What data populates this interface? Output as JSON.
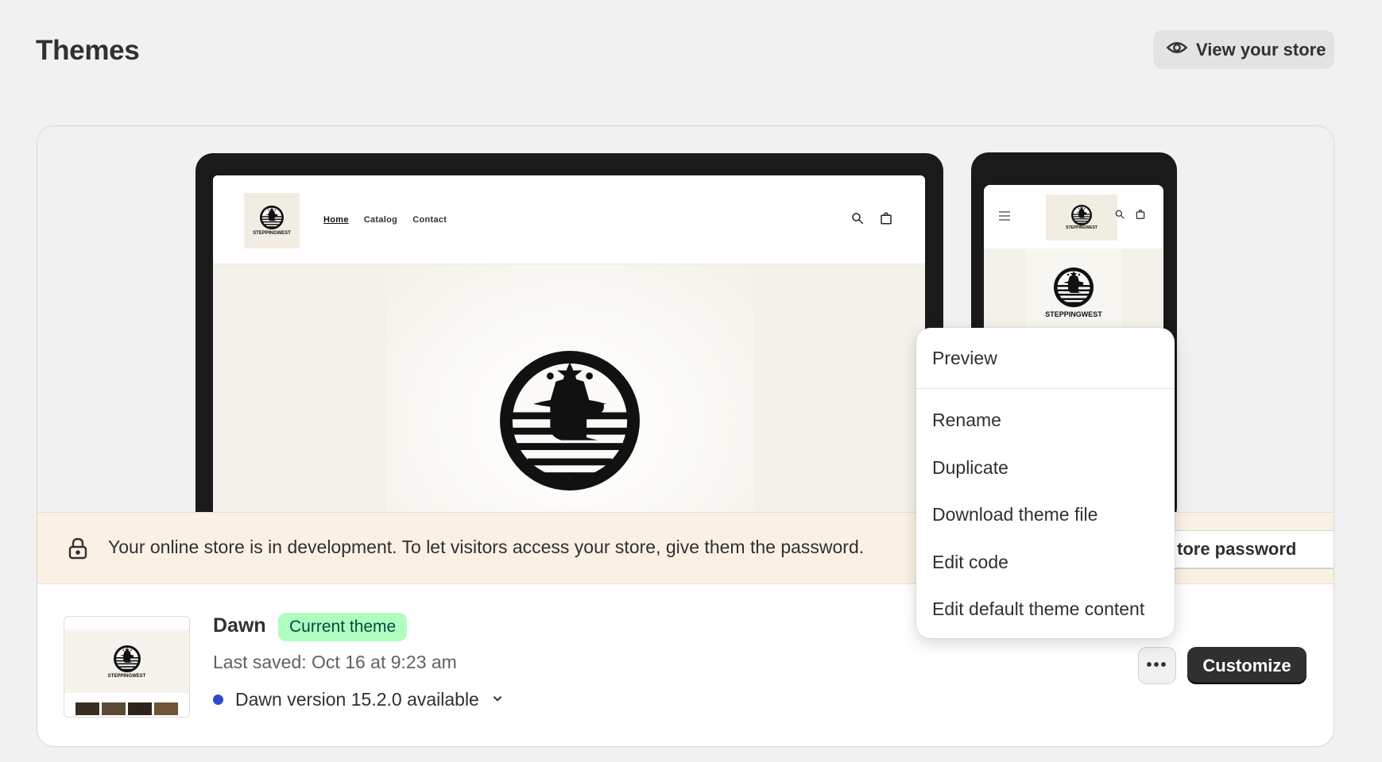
{
  "page": {
    "title": "Themes",
    "view_store_label": "View your store"
  },
  "preview": {
    "desktop": {
      "brand": "STEPPINGWEST",
      "nav": [
        "Home",
        "Catalog",
        "Contact"
      ]
    },
    "mobile": {
      "brand": "STEPPINGWEST"
    }
  },
  "banner": {
    "message": "Your online store is in development. To let visitors access your store, give them the password.",
    "password_button": "tore password"
  },
  "theme": {
    "name": "Dawn",
    "badge": "Current theme",
    "last_saved": "Last saved: Oct 16 at 9:23 am",
    "version": "Dawn version 15.2.0 available",
    "thumb_brand": "STEPPINGWEST",
    "more_label": "•••",
    "customize_label": "Customize"
  },
  "menu": {
    "preview": "Preview",
    "rename": "Rename",
    "duplicate": "Duplicate",
    "download": "Download theme file",
    "edit_code": "Edit code",
    "edit_content": "Edit default theme content"
  },
  "colors": {
    "badge_bg": "#affebf",
    "banner_bg": "#faf1e4",
    "version_dot": "#3048d0",
    "customize_bg": "#303030"
  }
}
